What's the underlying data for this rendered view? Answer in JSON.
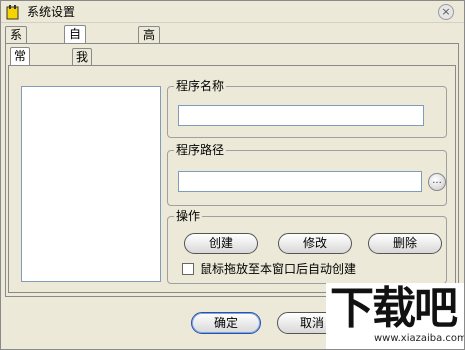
{
  "window": {
    "title": "系统设置",
    "close_symbol": "×"
  },
  "tabs": [
    {
      "label": "系统程序",
      "active": false
    },
    {
      "label": "自定义菜单",
      "active": true
    },
    {
      "label": "高级设置",
      "active": false
    }
  ],
  "subtabs": [
    {
      "label": "常用程序",
      "active": true
    },
    {
      "label": "我的电脑",
      "active": false
    }
  ],
  "program_name": {
    "label": "程序名称",
    "value": ""
  },
  "program_path": {
    "label": "程序路径",
    "value": "",
    "browse_symbol": "..."
  },
  "operations": {
    "label": "操作",
    "create": "创建",
    "modify": "修改",
    "delete": "删除",
    "auto_create_label": "鼠标拖放至本窗口后自动创建",
    "auto_create_checked": false
  },
  "footer": {
    "ok": "确定",
    "cancel": "取消"
  },
  "watermark": {
    "logo": "下载吧",
    "url": "www.xiazaiba.com"
  }
}
